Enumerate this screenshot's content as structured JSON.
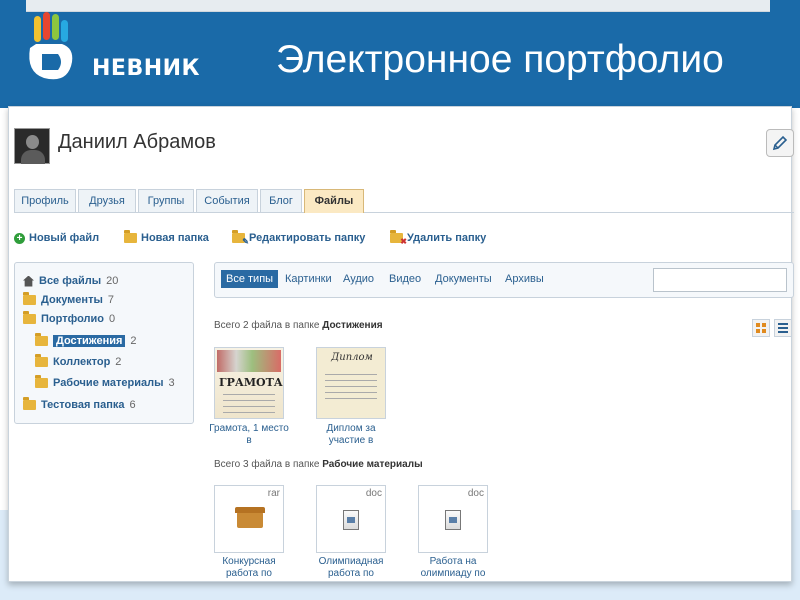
{
  "slide": {
    "logo_text": "НЕВНИК",
    "title": "Электронное портфолио",
    "colors": {
      "header_bg": "#1a6aa8",
      "accent": "#2a6aa3"
    }
  },
  "profile": {
    "name": "Даниил Абрамов",
    "edit_icon": "pencil-icon"
  },
  "tabs": [
    {
      "label": "Профиль"
    },
    {
      "label": "Друзья"
    },
    {
      "label": "Группы"
    },
    {
      "label": "События"
    },
    {
      "label": "Блог"
    },
    {
      "label": "Файлы",
      "active": true
    }
  ],
  "actions": [
    {
      "label": "Новый файл",
      "icon": "plus-icon"
    },
    {
      "label": "Новая папка",
      "icon": "folder-icon"
    },
    {
      "label": "Редактировать папку",
      "icon": "folder-edit-icon"
    },
    {
      "label": "Удалить папку",
      "icon": "folder-delete-icon"
    }
  ],
  "tree": [
    {
      "label": "Все файлы",
      "count": "20",
      "icon": "home-icon"
    },
    {
      "label": "Документы",
      "count": "7",
      "icon": "folder-icon"
    },
    {
      "label": "Портфолио",
      "count": "0",
      "icon": "folder-icon"
    },
    {
      "label": "Достижения",
      "count": "2",
      "icon": "folder-icon",
      "selected": true
    },
    {
      "label": "Коллектор",
      "count": "2",
      "icon": "folder-icon"
    },
    {
      "label": "Рабочие материалы",
      "count": "3",
      "icon": "folder-icon"
    },
    {
      "label": "Тестовая папка",
      "count": "6",
      "icon": "folder-icon"
    }
  ],
  "filters": [
    {
      "label": "Все типы",
      "active": true
    },
    {
      "label": "Картинки"
    },
    {
      "label": "Аудио"
    },
    {
      "label": "Видео"
    },
    {
      "label": "Документы"
    },
    {
      "label": "Архивы"
    }
  ],
  "search": {
    "value": ""
  },
  "groups": [
    {
      "prefix": "Всего 2 файла в папке",
      "folder": "Достижения",
      "files": [
        {
          "caption": "Грамота, 1 место в",
          "thumb_text": "ГРАМОТА"
        },
        {
          "caption": "Диплом за участие в",
          "thumb_text": "Диплом"
        }
      ]
    },
    {
      "prefix": "Всего 3 файла в папке",
      "folder": "Рабочие материалы",
      "files": [
        {
          "caption": "Конкурсная работа по",
          "ext": "rar",
          "icon": "archive-box-icon"
        },
        {
          "caption": "Олимпиадная работа по",
          "ext": "doc",
          "icon": "document-icon"
        },
        {
          "caption": "Работа на олимпиаду по",
          "ext": "doc",
          "icon": "document-icon"
        }
      ]
    }
  ],
  "view_buttons": [
    {
      "icon": "grid-view-icon"
    },
    {
      "icon": "list-view-icon"
    }
  ]
}
